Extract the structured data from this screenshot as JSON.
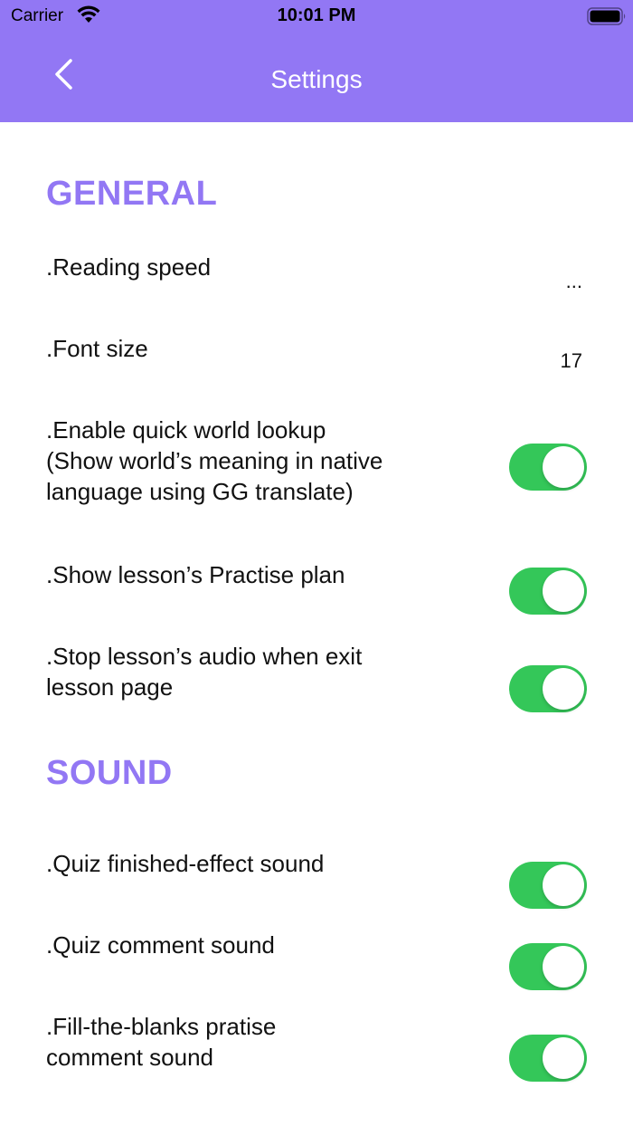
{
  "status_bar": {
    "carrier": "Carrier",
    "time": "10:01 PM",
    "wifi_icon": "wifi-icon",
    "battery_icon": "battery-icon"
  },
  "nav": {
    "back_icon": "chevron-left-icon",
    "title": "Settings"
  },
  "colors": {
    "accent": "#9277f4",
    "toggle_on": "#34c759"
  },
  "sections": {
    "general": {
      "title": "GENERAL",
      "reading_speed": {
        "label": ".Reading speed",
        "value": "..."
      },
      "font_size": {
        "label": ".Font size",
        "value": "17"
      },
      "quick_lookup": {
        "line1": ".Enable quick world lookup",
        "line2": "(Show world’s meaning in native",
        "line3": "language using GG translate)",
        "on": true
      },
      "practise_plan": {
        "label": ".Show lesson’s Practise plan",
        "on": true
      },
      "stop_audio": {
        "line1": ".Stop lesson’s audio when exit",
        "line2": "lesson page",
        "on": true
      }
    },
    "sound": {
      "title": "SOUND",
      "quiz_finished": {
        "label": ".Quiz finished-effect sound",
        "on": true
      },
      "quiz_comment": {
        "label": ".Quiz comment sound",
        "on": true
      },
      "fill_blanks": {
        "line1": ".Fill-the-blanks pratise",
        "line2": "comment sound",
        "on": true
      }
    }
  }
}
